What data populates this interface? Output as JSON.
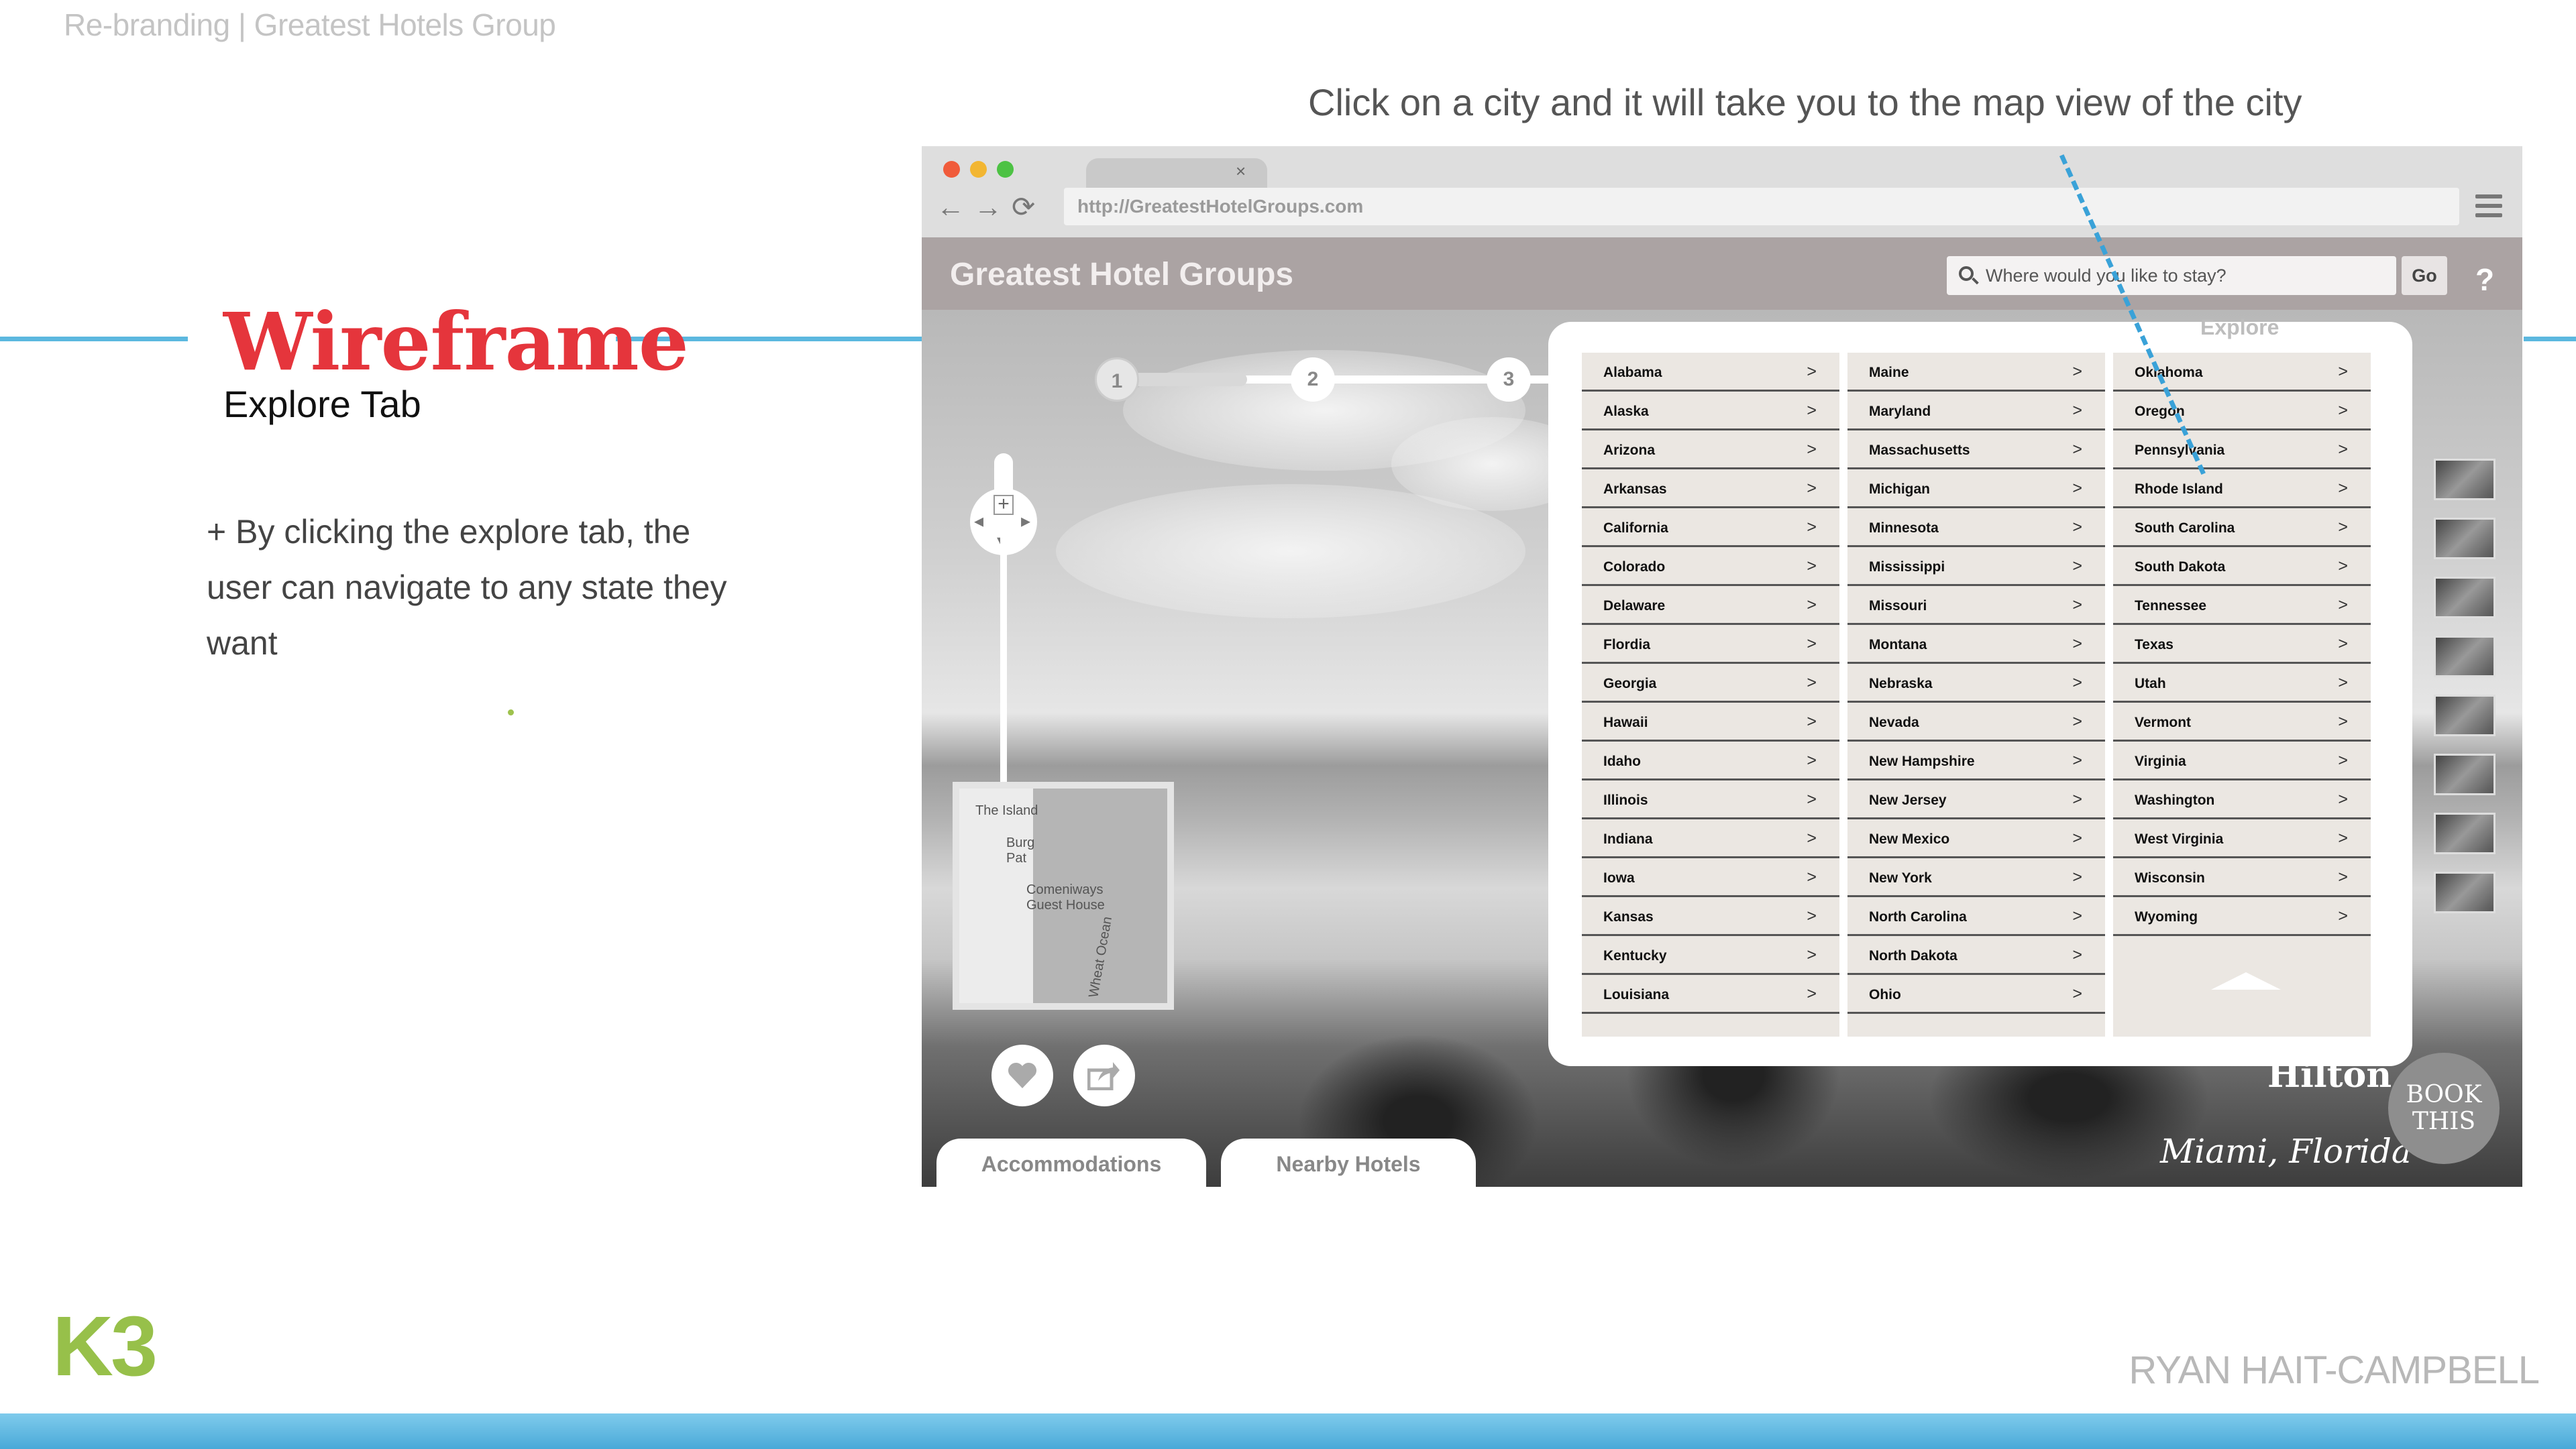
{
  "slide": {
    "header": "Re-branding | Greatest Hotels Group",
    "caption": "Click on a city and it will take you to the map view of the city",
    "title": "Wireframe",
    "subtitle": "Explore Tab",
    "bullet": "+  By clicking the explore tab, the user can navigate to any state they want",
    "logo": "K3",
    "author": "RYAN HAIT-CAMPBELL"
  },
  "browser": {
    "url": "http://GreatestHotelGroups.com",
    "tab_close": "×",
    "nav_icons": [
      "arrow-left-icon",
      "arrow-right-icon",
      "reload-icon"
    ],
    "traffic_colors": [
      "#f05b3b",
      "#f2b632",
      "#4dc244"
    ]
  },
  "site": {
    "title": "Greatest Hotel Groups",
    "search_placeholder": "Where would you like to stay?",
    "go_label": "Go",
    "help_label": "?",
    "steps": [
      "1",
      "2",
      "3"
    ],
    "zoom_in": "+",
    "zoom_out": "−",
    "minimap_labels": [
      "The Island",
      "Burg Pat",
      "Comeniways Guest House",
      "Wheat Ocean"
    ],
    "tabs": [
      "Accommodations",
      "Nearby Hotels"
    ],
    "brand": "Hilton",
    "location": "Miami, Florida",
    "book_label_1": "BOOK",
    "book_label_2": "THIS"
  },
  "explore": {
    "label": "Explore",
    "arrow": ">",
    "columns": [
      [
        "Alabama",
        "Alaska",
        "Arizona",
        "Arkansas",
        "California",
        "Colorado",
        "Delaware",
        "Flordia",
        "Georgia",
        "Hawaii",
        "Idaho",
        "Illinois",
        "Indiana",
        "Iowa",
        "Kansas",
        "Kentucky",
        "Louisiana"
      ],
      [
        "Maine",
        "Maryland",
        "Massachusetts",
        "Michigan",
        "Minnesota",
        "Mississippi",
        "Missouri",
        "Montana",
        "Nebraska",
        "Nevada",
        "New Hampshire",
        "New Jersey",
        "New Mexico",
        "New York",
        "North Carolina",
        "North Dakota",
        "Ohio"
      ],
      [
        "Oklahoma",
        "Oregon",
        "Pennsylvania",
        "Rhode Island",
        "South Carolina",
        "South Dakota",
        "Tennessee",
        "Texas",
        "Utah",
        "Vermont",
        "Virginia",
        "Washington",
        "West Virginia",
        "Wisconsin",
        "Wyoming"
      ]
    ]
  },
  "colors": {
    "accent_red": "#e5353c",
    "accent_blue": "#5cb8df",
    "accent_green": "#97c04a"
  }
}
